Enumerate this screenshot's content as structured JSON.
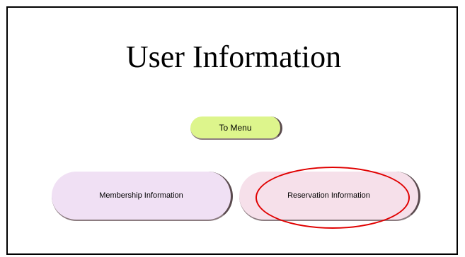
{
  "page": {
    "title": "User Information"
  },
  "buttons": {
    "menu_label": "To Menu",
    "membership_label": "Membership Information",
    "reservation_label": "Reservation Information"
  },
  "colors": {
    "menu_button": "#ddf58c",
    "membership_button": "#f0e0f4",
    "reservation_button": "#f6e0ea",
    "highlight": "#e00000"
  }
}
